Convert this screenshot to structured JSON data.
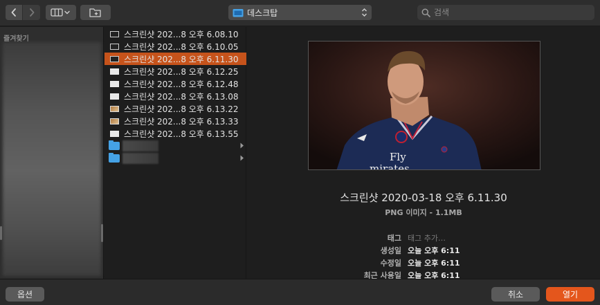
{
  "toolbar": {
    "location_label": "데스크탑",
    "search_placeholder": "검색"
  },
  "sidebar": {
    "header": "즐겨찾기"
  },
  "files": [
    {
      "name": "스크린샷 202...8 오후 6.08.10",
      "thumb": "dark",
      "selected": false
    },
    {
      "name": "스크린샷 202...8 오후 6.10.05",
      "thumb": "dark",
      "selected": false
    },
    {
      "name": "스크린샷 202...8 오후 6.11.30",
      "thumb": "dark",
      "selected": true
    },
    {
      "name": "스크린샷 202...8 오후 6.12.25",
      "thumb": "light",
      "selected": false
    },
    {
      "name": "스크린샷 202...8 오후 6.12.48",
      "thumb": "light",
      "selected": false
    },
    {
      "name": "스크린샷 202...8 오후 6.13.08",
      "thumb": "light",
      "selected": false
    },
    {
      "name": "스크린샷 202...8 오후 6.13.22",
      "thumb": "pic",
      "selected": false
    },
    {
      "name": "스크린샷 202...8 오후 6.13.33",
      "thumb": "pic",
      "selected": false
    },
    {
      "name": "스크린샷 202...8 오후 6.13.55",
      "thumb": "light",
      "selected": false
    }
  ],
  "preview": {
    "title": "스크린샷 2020-03-18 오후 6.11.30",
    "subtitle": "PNG 이미지 - 1.1MB",
    "image_caption_top": "Fly",
    "image_caption_bottom": "mirates",
    "meta": [
      {
        "key": "태그",
        "value": "태그 추가…",
        "placeholder": true
      },
      {
        "key": "생성일",
        "value": "오늘 오후 6:11",
        "placeholder": false
      },
      {
        "key": "수정일",
        "value": "오늘 오후 6:11",
        "placeholder": false
      },
      {
        "key": "최근 사용일",
        "value": "오늘 오후 6:11",
        "placeholder": false
      }
    ]
  },
  "buttons": {
    "options": "옵션",
    "cancel": "취소",
    "open": "열기"
  },
  "colors": {
    "accent": "#e4561c",
    "selection": "#c6531b",
    "folder": "#45a2e6"
  }
}
